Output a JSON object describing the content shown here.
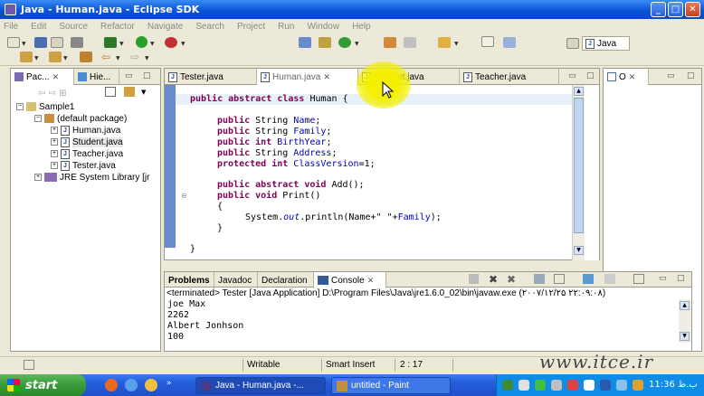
{
  "window": {
    "title": "Java - Human.java - Eclipse SDK"
  },
  "menu": [
    "File",
    "Edit",
    "Source",
    "Refactor",
    "Navigate",
    "Search",
    "Project",
    "Run",
    "Window",
    "Help"
  ],
  "perspective": {
    "label": "Java"
  },
  "left_panel": {
    "tabs": [
      {
        "label": "Pac..."
      },
      {
        "label": "Hie..."
      }
    ],
    "tree": [
      {
        "label": "Sample1",
        "depth": 0
      },
      {
        "label": "(default package)",
        "depth": 1
      },
      {
        "label": "Human.java",
        "depth": 2
      },
      {
        "label": "Student.java",
        "depth": 2
      },
      {
        "label": "Teacher.java",
        "depth": 2
      },
      {
        "label": "Tester.java",
        "depth": 2
      },
      {
        "label": "JRE System Library [jr",
        "depth": 1
      }
    ]
  },
  "editor": {
    "tabs": [
      {
        "label": "Tester.java"
      },
      {
        "label": "Human.java"
      },
      {
        "label": "Student.java"
      },
      {
        "label": "Teacher.java"
      }
    ],
    "code": {
      "l1_kw": "public abstract class",
      "l1_name": " Human {",
      "l2_kw": "public",
      "l2_type": " String ",
      "l2_field": "Name",
      "l2_end": ";",
      "l3_kw": "public",
      "l3_type": " String ",
      "l3_field": "Family",
      "l3_end": ";",
      "l4_kw": "public int",
      "l4_field": " BirthYear",
      "l4_end": ";",
      "l5_kw": "public",
      "l5_type": " String ",
      "l5_field": "Address",
      "l5_end": ";",
      "l6_kw": "protected int",
      "l6_field": " ClassVersion",
      "l6_end": "=1;",
      "l7_kw": "public abstract void",
      "l7_rest": " Add();",
      "l8_kw": "public void",
      "l8_rest": " Print()",
      "l9": "{",
      "l10_a": "System.",
      "l10_out": "out",
      "l10_b": ".println(Name+\" \"+",
      "l10_fam": "Family",
      "l10_c": ");",
      "l11": "}",
      "l12": "}"
    }
  },
  "outline": {
    "tab_label": "O"
  },
  "bottom": {
    "tabs": [
      {
        "label": "Problems"
      },
      {
        "label": "Javadoc"
      },
      {
        "label": "Declaration"
      },
      {
        "label": "Console"
      }
    ],
    "terminated": "<terminated> Tester [Java Application] D:\\Program Files\\Java\\jre1.6.0_02\\bin\\javaw.exe (۲۰۰۷/۱۲/۲۵ ۲۲:۰۹:۰۸)",
    "lines": [
      "joe Max",
      "2262",
      "Albert Jonhson",
      "100"
    ]
  },
  "status": {
    "writable": "Writable",
    "insert_mode": "Smart Insert",
    "position": "2 : 17"
  },
  "watermark": "www.itce.ir",
  "taskbar": {
    "start": "start",
    "tasks": [
      {
        "label": "Java - Human.java -..."
      },
      {
        "label": "untitled - Paint"
      }
    ],
    "clock": "11:36 ب.ظ"
  }
}
